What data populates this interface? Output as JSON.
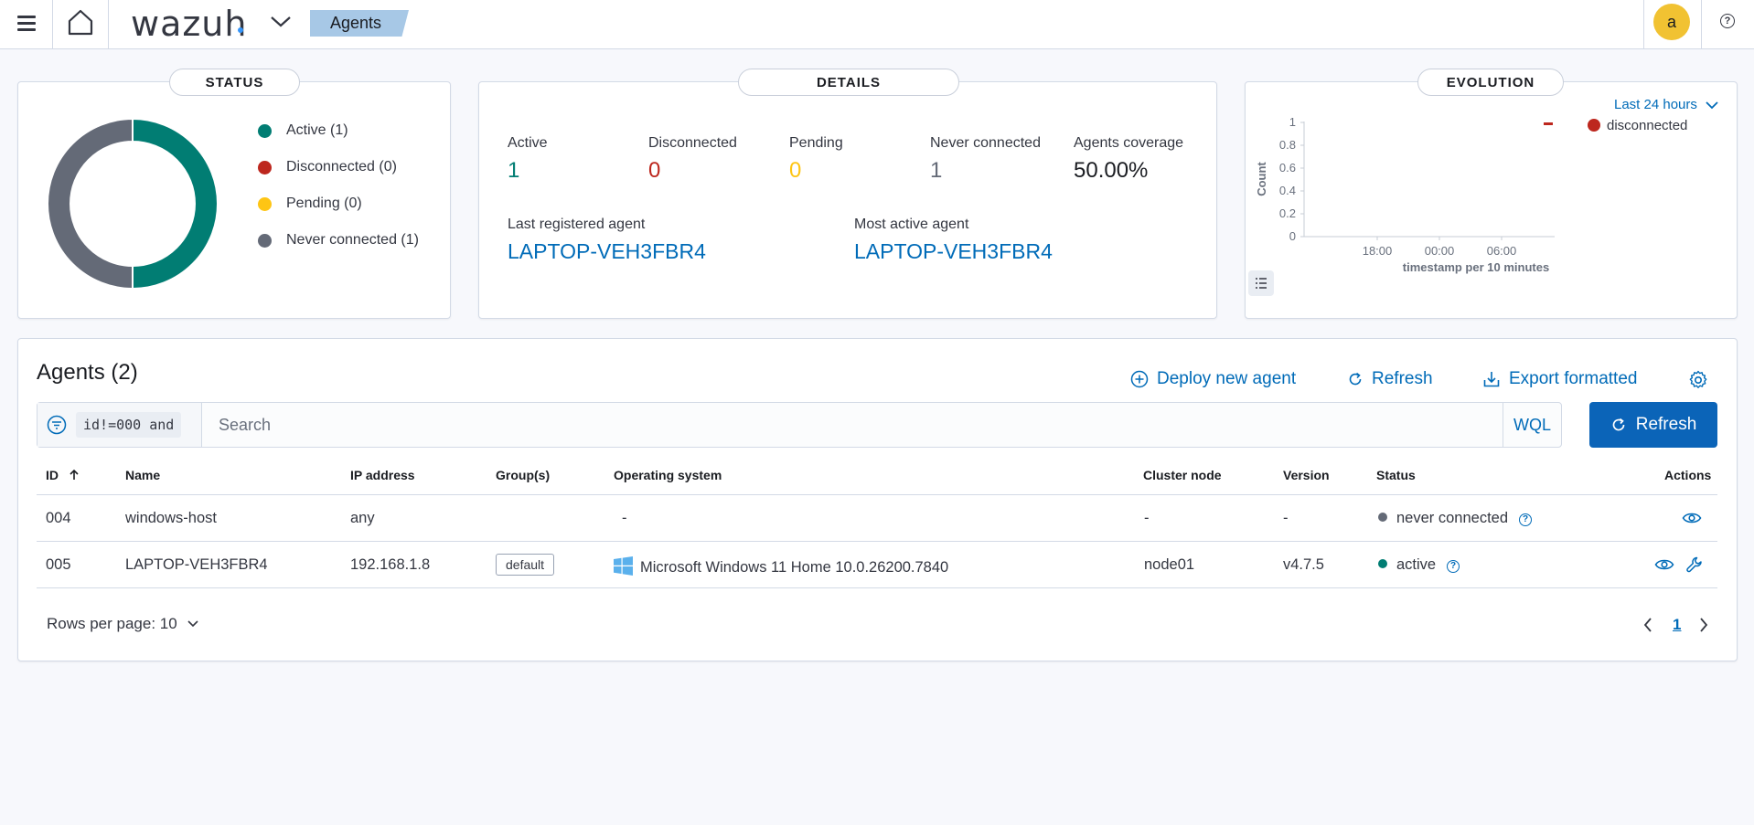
{
  "header": {
    "logo_text": "wazuh",
    "breadcrumb": "Agents",
    "avatar_initial": "a",
    "help_symbol": "?"
  },
  "status_panel": {
    "title": "STATUS",
    "legend": [
      {
        "label": "Active (1)",
        "color": "#017d73"
      },
      {
        "label": "Disconnected (0)",
        "color": "#bd271e"
      },
      {
        "label": "Pending (0)",
        "color": "#fec514"
      },
      {
        "label": "Never connected (1)",
        "color": "#646a77"
      }
    ],
    "donut": {
      "active": 1,
      "disconnected": 0,
      "pending": 0,
      "never_connected": 1
    }
  },
  "details_panel": {
    "title": "DETAILS",
    "stats": [
      {
        "label": "Active",
        "value": "1",
        "color": "#017d73"
      },
      {
        "label": "Disconnected",
        "value": "0",
        "color": "#bd271e"
      },
      {
        "label": "Pending",
        "value": "0",
        "color": "#fec514"
      },
      {
        "label": "Never connected",
        "value": "1",
        "color": "#646a77"
      },
      {
        "label": "Agents coverage",
        "value": "50.00%",
        "color": "#1a1c21"
      }
    ],
    "last_registered_label": "Last registered agent",
    "last_registered_value": "LAPTOP-VEH3FBR4",
    "most_active_label": "Most active agent",
    "most_active_value": "LAPTOP-VEH3FBR4"
  },
  "evolution_panel": {
    "title": "EVOLUTION",
    "time_range": "Last 24 hours",
    "chart_data": {
      "type": "bar",
      "ylabel": "Count",
      "xlabel": "timestamp per 10 minutes",
      "y_ticks": [
        "1",
        "0.8",
        "0.6",
        "0.4",
        "0.2",
        "0"
      ],
      "x_ticks": [
        "18:00",
        "00:00",
        "06:00"
      ],
      "ylim": [
        0,
        1
      ],
      "series": [
        {
          "name": "disconnected",
          "color": "#bd271e",
          "values": []
        }
      ],
      "legend_position": "top-right"
    }
  },
  "agents": {
    "title": "Agents (2)",
    "deploy_label": "Deploy new agent",
    "refresh_link_label": "Refresh",
    "export_label": "Export formatted",
    "search_prefix": "id!=000 and",
    "search_placeholder": "Search",
    "wql_label": "WQL",
    "refresh_button_label": "Refresh",
    "columns": [
      "ID",
      "Name",
      "IP address",
      "Group(s)",
      "Operating system",
      "Cluster node",
      "Version",
      "Status",
      "Actions"
    ],
    "rows": [
      {
        "id": "004",
        "name": "windows-host",
        "ip": "any",
        "group": "",
        "os": "-",
        "cluster": "-",
        "version": "-",
        "status": "never connected",
        "status_color": "#646a77"
      },
      {
        "id": "005",
        "name": "LAPTOP-VEH3FBR4",
        "ip": "192.168.1.8",
        "group": "default",
        "os": "Microsoft Windows 11 Home 10.0.26200.7840",
        "cluster": "node01",
        "version": "v4.7.5",
        "status": "active",
        "status_color": "#017d73"
      }
    ],
    "rows_per_page_label": "Rows per page: 10",
    "current_page": "1"
  }
}
